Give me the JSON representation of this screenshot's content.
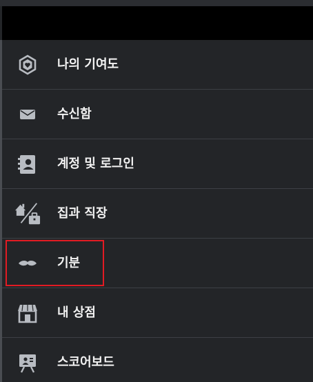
{
  "menu": {
    "items": [
      {
        "label": "나의 기여도",
        "icon": "contribution-icon"
      },
      {
        "label": "수신함",
        "icon": "inbox-icon"
      },
      {
        "label": "계정 및 로그인",
        "icon": "account-icon"
      },
      {
        "label": "집과 직장",
        "icon": "home-work-icon"
      },
      {
        "label": "기분",
        "icon": "mood-icon"
      },
      {
        "label": "내 상점",
        "icon": "store-icon"
      },
      {
        "label": "스코어보드",
        "icon": "scoreboard-icon"
      }
    ]
  },
  "highlight": {
    "color": "#e31b23",
    "target": "기분"
  },
  "colors": {
    "background": "#232528",
    "header": "#000000",
    "icon": "#b8bcc2",
    "text": "#f2f2f2",
    "divider": "#3d4045"
  }
}
